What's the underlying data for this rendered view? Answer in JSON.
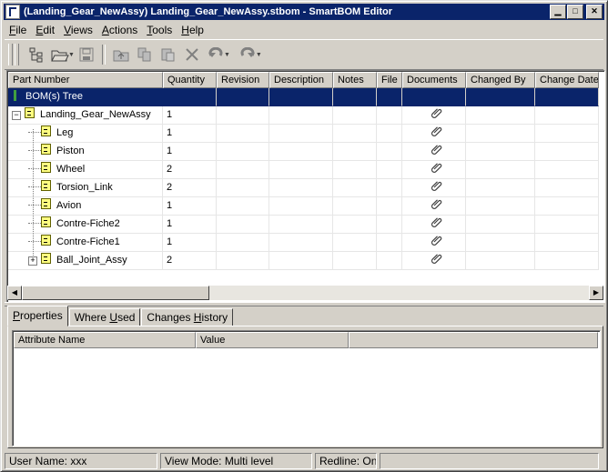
{
  "window": {
    "title": "(Landing_Gear_NewAssy) Landing_Gear_NewAssy.stbom - SmartBOM Editor"
  },
  "menu": [
    {
      "pre": "",
      "key": "F",
      "post": "ile"
    },
    {
      "pre": "",
      "key": "E",
      "post": "dit"
    },
    {
      "pre": "",
      "key": "V",
      "post": "iews"
    },
    {
      "pre": "",
      "key": "A",
      "post": "ctions"
    },
    {
      "pre": "",
      "key": "T",
      "post": "ools"
    },
    {
      "pre": "",
      "key": "H",
      "post": "elp"
    }
  ],
  "grid": {
    "columns": [
      "Part Number",
      "Quantity",
      "Revision",
      "Description",
      "Notes",
      "File",
      "Documents",
      "Changed By",
      "Change Date"
    ],
    "root_label": "BOM(s) Tree",
    "rows": [
      {
        "part": "Landing_Gear_NewAssy",
        "qty": "1",
        "level": 0,
        "expander": "−"
      },
      {
        "part": "Leg",
        "qty": "1",
        "level": 1,
        "expander": ""
      },
      {
        "part": "Piston",
        "qty": "1",
        "level": 1,
        "expander": ""
      },
      {
        "part": "Wheel",
        "qty": "2",
        "level": 1,
        "expander": ""
      },
      {
        "part": "Torsion_Link",
        "qty": "2",
        "level": 1,
        "expander": ""
      },
      {
        "part": "Avion",
        "qty": "1",
        "level": 1,
        "expander": ""
      },
      {
        "part": "Contre-Fiche2",
        "qty": "1",
        "level": 1,
        "expander": ""
      },
      {
        "part": "Contre-Fiche1",
        "qty": "1",
        "level": 1,
        "expander": ""
      },
      {
        "part": "Ball_Joint_Assy",
        "qty": "2",
        "level": 1,
        "expander": "+"
      }
    ]
  },
  "tabs": [
    {
      "pre": "",
      "key": "P",
      "post": "roperties"
    },
    {
      "pre": "Where ",
      "key": "U",
      "post": "sed"
    },
    {
      "pre": "Changes ",
      "key": "H",
      "post": "istory"
    }
  ],
  "properties": {
    "columns": [
      "Attribute Name",
      "Value"
    ]
  },
  "status": {
    "user": "User Name: xxx",
    "view_mode": "View Mode: Multi level",
    "redline": "Redline: On"
  },
  "icons": {
    "minimize": "minimize-icon",
    "maximize": "maximize-icon",
    "close": "close-icon",
    "attachment": "paperclip-icon"
  },
  "colors": {
    "titlebar": "#0a246a",
    "selection": "#0a246a",
    "face": "#d4d0c8"
  }
}
